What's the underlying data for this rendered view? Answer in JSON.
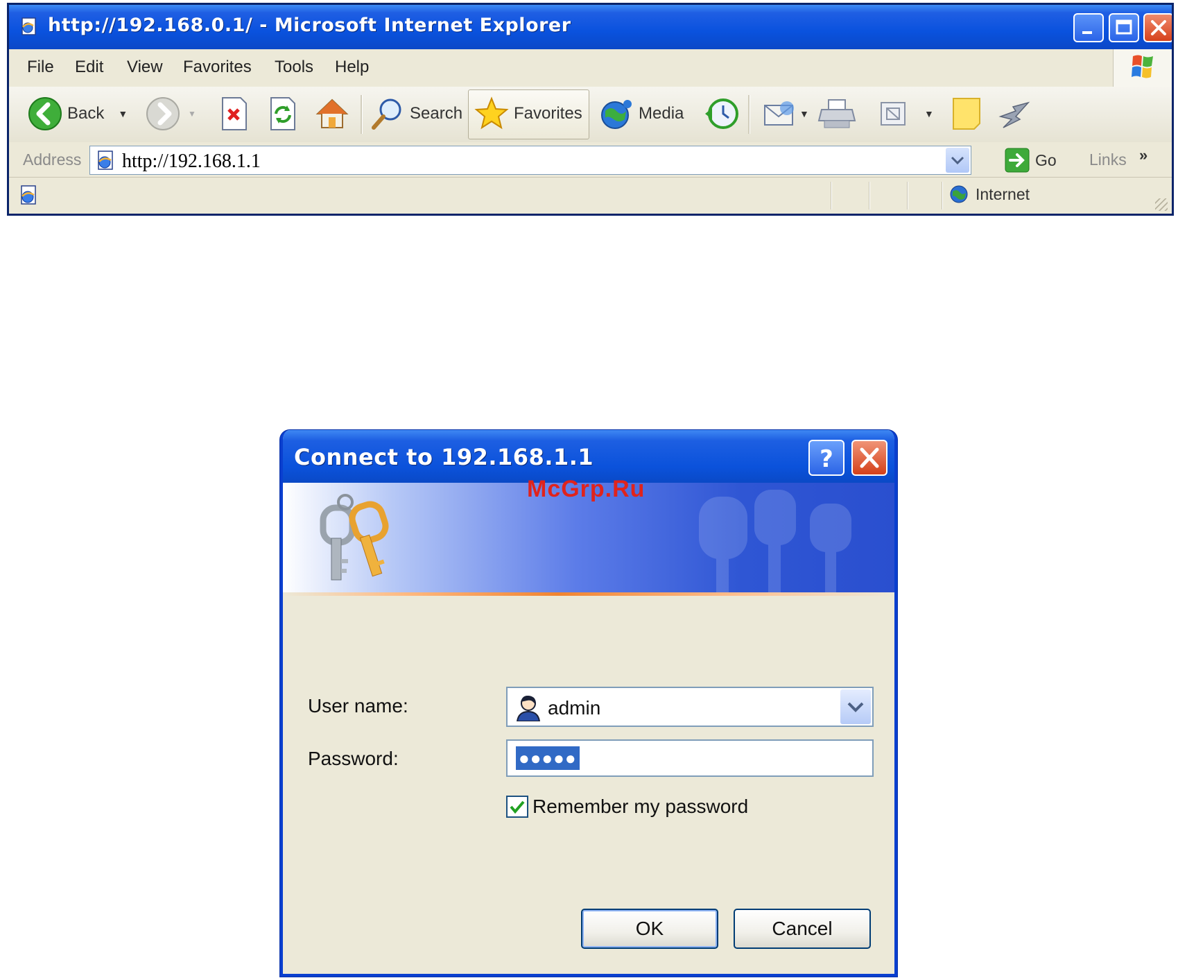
{
  "browser": {
    "window_title": "http://192.168.0.1/ - Microsoft Internet Explorer",
    "menu": [
      "File",
      "Edit",
      "View",
      "Favorites",
      "Tools",
      "Help"
    ],
    "toolbar": {
      "back_label": "Back",
      "search_label": "Search",
      "favorites_label": "Favorites",
      "media_label": "Media"
    },
    "address": {
      "label": "Address",
      "value": "http://192.168.1.1",
      "go_label": "Go",
      "links_label": "Links",
      "chevron": "»"
    },
    "status": {
      "zone_label": "Internet"
    }
  },
  "dialog": {
    "title": "Connect to 192.168.1.1",
    "help_glyph": "?",
    "watermark": "McGrp.Ru",
    "username_label": "User name:",
    "username_value": "admin",
    "password_label": "Password:",
    "password_mask": "●●●●●",
    "remember_label": "Remember my password",
    "remember_checked": true,
    "ok_label": "OK",
    "cancel_label": "Cancel"
  },
  "colors": {
    "xp_title_blue": "#0a52de",
    "dialog_face": "#ece9d8",
    "close_red": "#d6421c",
    "selection_blue": "#316ac5",
    "watermark_red": "#e0231c"
  },
  "icons": [
    "ie-page-icon",
    "minimize-icon",
    "maximize-icon",
    "close-icon",
    "windows-logo-icon",
    "back-arrow-icon",
    "forward-arrow-icon",
    "stop-icon",
    "refresh-icon",
    "home-icon",
    "search-icon",
    "favorites-star-icon",
    "media-icon",
    "history-icon",
    "mail-icon",
    "print-icon",
    "edit-icon",
    "messenger-icon",
    "go-arrow-icon",
    "globe-icon",
    "keys-icon",
    "user-icon",
    "help-icon",
    "checkmark-icon"
  ]
}
